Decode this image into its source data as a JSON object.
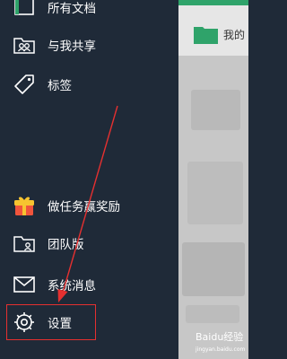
{
  "drawer": {
    "items": [
      {
        "label": "所有文档",
        "icon": "all-docs-icon"
      },
      {
        "label": "与我共享",
        "icon": "shared-with-me-icon"
      },
      {
        "label": "标签",
        "icon": "tag-icon"
      },
      {
        "label": "做任务赢奖励",
        "icon": "gift-icon"
      },
      {
        "label": "团队版",
        "icon": "team-folder-icon"
      },
      {
        "label": "系统消息",
        "icon": "mail-icon"
      },
      {
        "label": "设置",
        "icon": "gear-icon"
      }
    ]
  },
  "background": {
    "folder_title": "我的",
    "accent_color": "#2fa36a"
  },
  "watermark": {
    "brand": "Baidu经验",
    "url": "jingyan.baidu.com"
  },
  "annotation": {
    "highlight_color": "#e53030"
  }
}
